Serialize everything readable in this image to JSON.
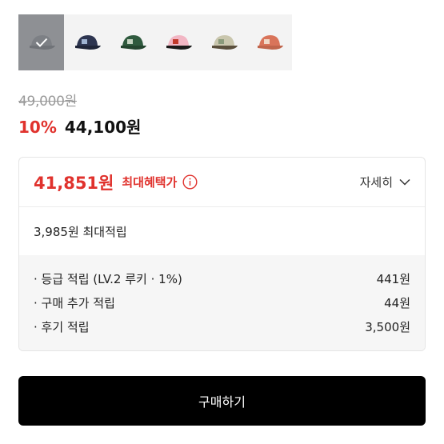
{
  "swatches": [
    {
      "name": "gray",
      "color": "#8e9094",
      "brim": "#8e9094",
      "selected": true
    },
    {
      "name": "navy",
      "color": "#2d3550",
      "brim": "#1f2538",
      "selected": false
    },
    {
      "name": "green",
      "color": "#2f5a3e",
      "brim": "#24452f",
      "selected": false
    },
    {
      "name": "pink",
      "color": "#f2b6c4",
      "brim": "#1a1a1a",
      "selected": false
    },
    {
      "name": "beige",
      "color": "#c9c6ad",
      "brim": "#5a4f3c",
      "selected": false
    },
    {
      "name": "orange",
      "color": "#d9745a",
      "brim": "#c0654c",
      "selected": false
    }
  ],
  "price": {
    "original": "49,000원",
    "discount": "10%",
    "sale": "44,100원"
  },
  "benefit": {
    "best_price": "41,851원",
    "best_label": "최대혜택가",
    "detail_label": "자세히",
    "max_points": "3,985원 최대적립",
    "points": [
      {
        "label": "· 등급 적립 (LV.2 루키 · 1%)",
        "value": "441원"
      },
      {
        "label": "· 구매 추가 적립",
        "value": "44원"
      },
      {
        "label": "· 후기 적립",
        "value": "3,500원"
      }
    ]
  },
  "buy_button_label": "구매하기",
  "colors": {
    "accent": "#e0322d",
    "button_bg": "#000000"
  }
}
